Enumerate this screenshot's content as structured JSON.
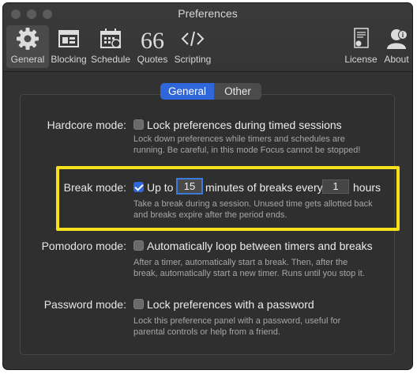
{
  "window": {
    "title": "Preferences"
  },
  "toolbar": {
    "items": [
      {
        "label": "General",
        "icon": "gear-icon",
        "selected": true
      },
      {
        "label": "Blocking",
        "icon": "window-icon"
      },
      {
        "label": "Schedule",
        "icon": "calendar-icon"
      },
      {
        "label": "Quotes",
        "icon": "quote-icon"
      },
      {
        "label": "Scripting",
        "icon": "code-icon"
      },
      {
        "label": "License",
        "icon": "certificate-icon"
      },
      {
        "label": "About",
        "icon": "user-info-icon"
      }
    ]
  },
  "tabs": {
    "general": "General",
    "other": "Other",
    "selected": "General"
  },
  "settings": {
    "hardcore": {
      "label": "Hardcore mode:",
      "checkbox": "Lock preferences during timed sessions",
      "checked": false,
      "desc1": "Lock down preferences while timers and schedules are",
      "desc2": "running. Be careful, in this mode Focus cannot be stopped!"
    },
    "break": {
      "label": "Break mode:",
      "checked": true,
      "prefix": "Up to",
      "minutes": "15",
      "middle": "minutes of breaks every",
      "hours": "1",
      "suffix": "hours",
      "desc1": "Take a break during a session. Unused time gets allotted back",
      "desc2": "and breaks expire after the period ends."
    },
    "pomodoro": {
      "label": "Pomodoro mode:",
      "checkbox": "Automatically loop between timers and breaks",
      "checked": false,
      "desc1": "After a timer, automatically start a break. Then, after the",
      "desc2": "break, automatically start a new timer. Runs until you stop it."
    },
    "password": {
      "label": "Password mode:",
      "checkbox": "Lock preferences with a password",
      "checked": false,
      "desc1": "Lock this preference panel with a password, useful for",
      "desc2": "parental controls or help from a friend."
    }
  },
  "colors": {
    "accent": "#2f66d9",
    "highlight": "#f4e01b",
    "background": "#323232"
  }
}
